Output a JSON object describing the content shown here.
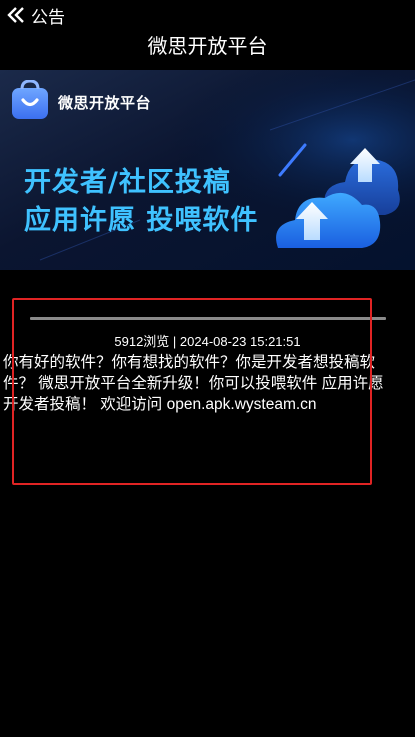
{
  "header": {
    "back_label": "公告",
    "title": "微思开放平台"
  },
  "banner": {
    "brand_name": "微思开放平台",
    "slogan_line1": "开发者/社区投稿",
    "slogan_line2": "应用许愿 投喂软件",
    "accent_color": "#3fc2ff"
  },
  "article": {
    "meta": "5912浏览 | 2024-08-23 15:21:51",
    "lines": [
      "你有好的软件？你有想找的软件？你是开发者想投稿软",
      "件？ 微思开放平台全新升级！你可以投喂软件 应用许愿",
      "开发者投稿！ 欢迎访问 open.apk.wysteam.cn"
    ]
  },
  "icons": {
    "back": "double-chevron-left-icon",
    "brand": "shopping-bag-icon",
    "art": "cloud-upload-icon"
  }
}
